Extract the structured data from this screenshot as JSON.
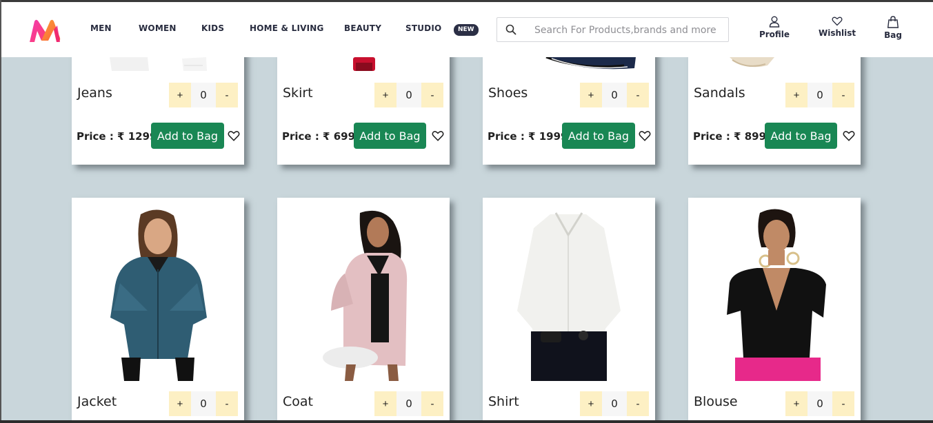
{
  "nav": {
    "items": [
      "MEN",
      "WOMEN",
      "KIDS",
      "HOME & LIVING",
      "BEAUTY",
      "STUDIO"
    ],
    "new_badge": "NEW"
  },
  "search": {
    "placeholder": "Search For Products,brands and more"
  },
  "actions": {
    "profile": "Profile",
    "wishlist": "Wishlist",
    "bag": "Bag"
  },
  "colors": {
    "brand_pink": "#ff3f6c",
    "brand_orange": "#f7a233",
    "add_button": "#198754",
    "qty_button": "#fdf0c4",
    "background": "#c9d6db"
  },
  "products_row1": [
    {
      "name": "Jeans",
      "qty": "0",
      "price": "Price : ₹ 1299",
      "add": "Add to Bag",
      "plus": "+",
      "minus": "-"
    },
    {
      "name": "Skirt",
      "qty": "0",
      "price": "Price : ₹ 699",
      "add": "Add to Bag",
      "plus": "+",
      "minus": "-"
    },
    {
      "name": "Shoes",
      "qty": "0",
      "price": "Price : ₹ 1999",
      "add": "Add to Bag",
      "plus": "+",
      "minus": "-"
    },
    {
      "name": "Sandals",
      "qty": "0",
      "price": "Price : ₹ 899",
      "add": "Add to Bag",
      "plus": "+",
      "minus": "-"
    }
  ],
  "products_row2": [
    {
      "name": "Jacket",
      "qty": "0",
      "plus": "+",
      "minus": "-"
    },
    {
      "name": "Coat",
      "qty": "0",
      "plus": "+",
      "minus": "-"
    },
    {
      "name": "Shirt",
      "qty": "0",
      "plus": "+",
      "minus": "-"
    },
    {
      "name": "Blouse",
      "qty": "0",
      "plus": "+",
      "minus": "-"
    }
  ]
}
